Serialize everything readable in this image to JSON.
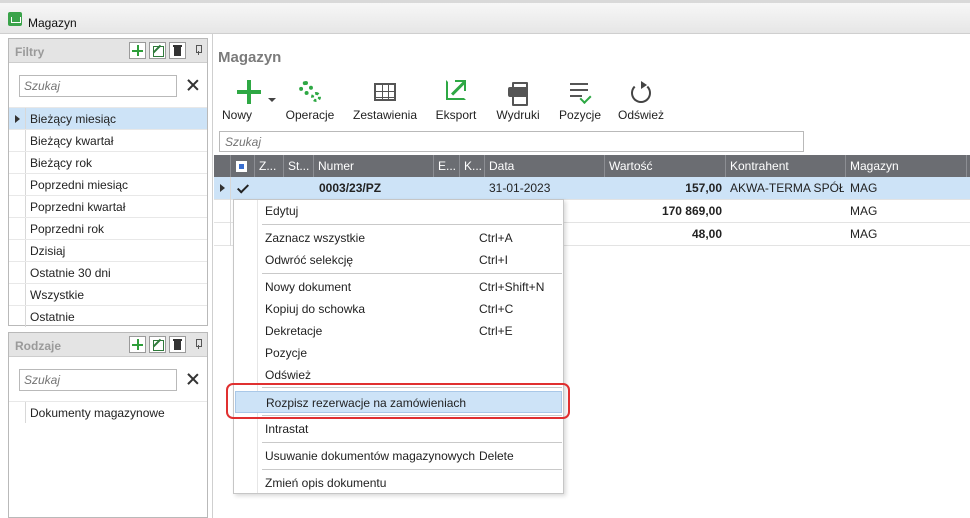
{
  "window": {
    "title": "Magazyn"
  },
  "filters_panel": {
    "title": "Filtry",
    "search_placeholder": "Szukaj",
    "items": [
      {
        "label": "Bieżący miesiąc",
        "selected": true
      },
      {
        "label": "Bieżący kwartał",
        "selected": false
      },
      {
        "label": "Bieżący rok",
        "selected": false
      },
      {
        "label": "Poprzedni miesiąc",
        "selected": false
      },
      {
        "label": "Poprzedni kwartał",
        "selected": false
      },
      {
        "label": "Poprzedni rok",
        "selected": false
      },
      {
        "label": "Dzisiaj",
        "selected": false
      },
      {
        "label": "Ostatnie 30 dni",
        "selected": false
      },
      {
        "label": "Wszystkie",
        "selected": false
      },
      {
        "label": "Ostatnie",
        "selected": false
      }
    ]
  },
  "types_panel": {
    "title": "Rodzaje",
    "search_placeholder": "Szukaj",
    "items": [
      {
        "label": "Dokumenty magazynowe"
      }
    ]
  },
  "main": {
    "title": "Magazyn",
    "toolbar": {
      "new": "Nowy",
      "operations": "Operacje",
      "summaries": "Zestawienia",
      "export": "Eksport",
      "prints": "Wydruki",
      "positions": "Pozycje",
      "refresh": "Odśwież"
    },
    "search_placeholder": "Szukaj"
  },
  "grid": {
    "columns": [
      "Z...",
      "St...",
      "Numer",
      "E...",
      "K...",
      "Data",
      "Wartość",
      "Kontrahent",
      "Magazyn"
    ],
    "rows": [
      {
        "checked": true,
        "numer": "0003/23/PZ",
        "data": "31-01-2023",
        "wartosc": "157,00",
        "kontrahent": "AKWA-TERMA SPÓŁK",
        "magazyn": "MAG"
      },
      {
        "checked": false,
        "numer": "",
        "data": "",
        "wartosc": "170 869,00",
        "kontrahent": "",
        "magazyn": "MAG"
      },
      {
        "checked": false,
        "numer": "",
        "data": "",
        "wartosc": "48,00",
        "kontrahent": "",
        "magazyn": "MAG"
      }
    ]
  },
  "context_menu": {
    "items": [
      {
        "label": "Edytuj",
        "shortcut": ""
      },
      {
        "label": "Zaznacz wszystkie",
        "shortcut": "Ctrl+A"
      },
      {
        "label": "Odwróć selekcję",
        "shortcut": "Ctrl+I"
      },
      {
        "label": "Nowy dokument",
        "shortcut": "Ctrl+Shift+N"
      },
      {
        "label": "Kopiuj do schowka",
        "shortcut": "Ctrl+C"
      },
      {
        "label": "Dekretacje",
        "shortcut": "Ctrl+E"
      },
      {
        "label": "Pozycje",
        "shortcut": ""
      },
      {
        "label": "Odśwież",
        "shortcut": ""
      },
      {
        "label": "Rozpisz rezerwacje na zamówieniach",
        "shortcut": ""
      },
      {
        "label": "Intrastat",
        "shortcut": ""
      },
      {
        "label": "Usuwanie dokumentów magazynowych",
        "shortcut": "Delete"
      },
      {
        "label": "Zmień opis dokumentu",
        "shortcut": ""
      }
    ]
  },
  "colors": {
    "accent_green": "#2ea844",
    "selection": "#cde3f7",
    "grid_header": "#6b6d72",
    "highlight_border": "#e03030"
  }
}
